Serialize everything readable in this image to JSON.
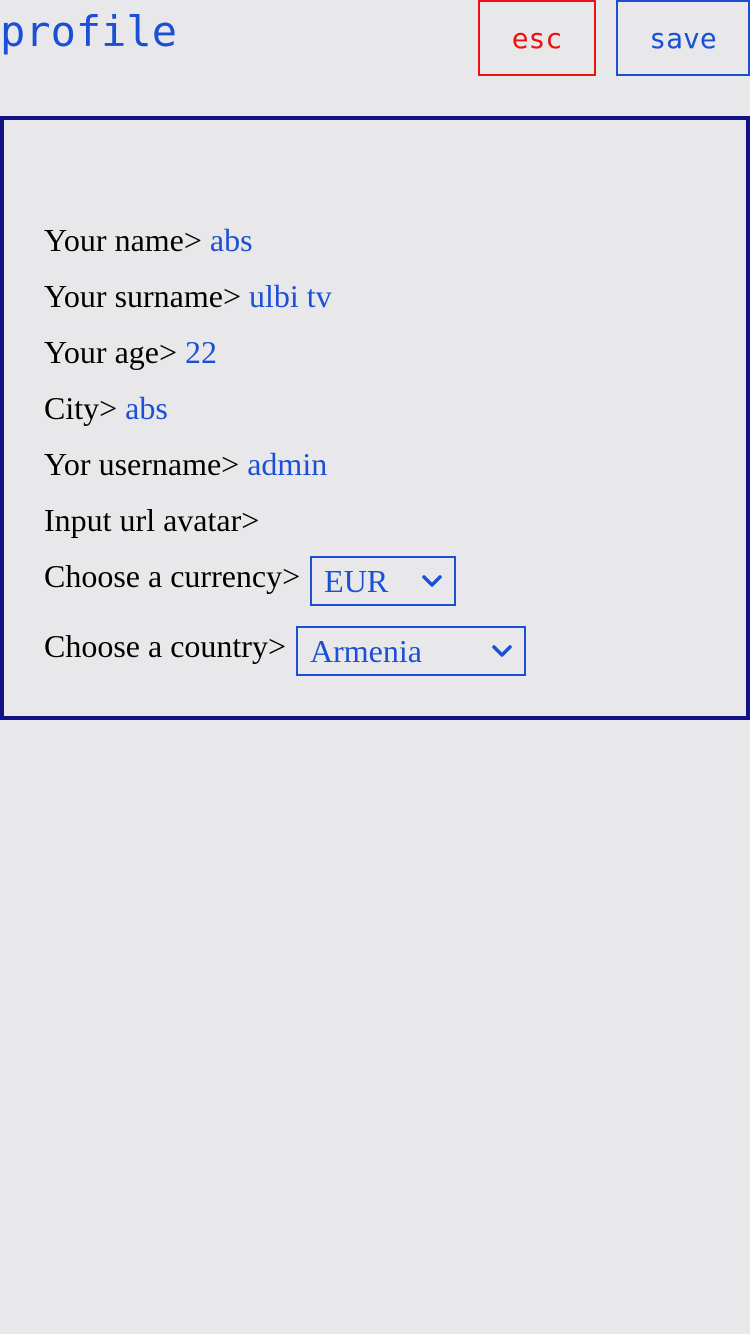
{
  "header": {
    "title": "profile",
    "esc_label": "esc",
    "save_label": "save"
  },
  "form": {
    "name": {
      "label": "Your name>",
      "value": "abs"
    },
    "surname": {
      "label": "Your surname>",
      "value": "ulbi tv"
    },
    "age": {
      "label": "Your age>",
      "value": "22"
    },
    "city": {
      "label": "City>",
      "value": "abs"
    },
    "username": {
      "label": "Yor username>",
      "value": "admin"
    },
    "avatar": {
      "label": "Input url avatar>",
      "value": ""
    },
    "currency": {
      "label": "Choose a currency>",
      "selected": "EUR"
    },
    "country": {
      "label": "Choose a country>",
      "selected": "Armenia"
    }
  },
  "colors": {
    "accent": "#1a4fd6",
    "danger": "#ee1111",
    "card_border": "#121285",
    "background": "#e8e8ea"
  },
  "icons": {
    "select_arrow": "chevron-down-icon"
  }
}
